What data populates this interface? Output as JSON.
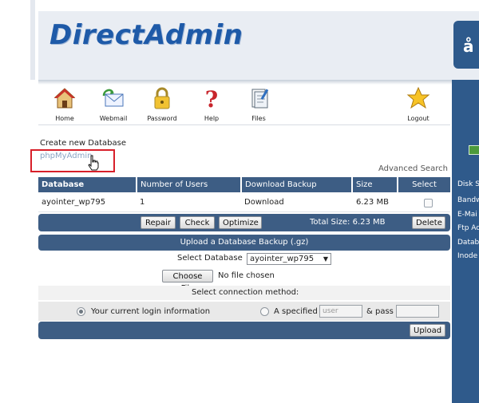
{
  "header": {
    "logo_text": "DirectAdmin",
    "side_tab_glyph": "å"
  },
  "toolbar": [
    {
      "label": "Home",
      "icon": "home-icon"
    },
    {
      "label": "Webmail",
      "icon": "webmail-icon"
    },
    {
      "label": "Password",
      "icon": "password-lock-icon"
    },
    {
      "label": "Help",
      "icon": "help-question-icon"
    },
    {
      "label": "Files",
      "icon": "files-icon"
    },
    {
      "label": "Logout",
      "icon": "logout-star-icon"
    }
  ],
  "links": {
    "create_db": "Create new Database",
    "phpmyadmin": "phpMyAdmin",
    "advanced_search": "Advanced Search"
  },
  "table": {
    "headers": [
      "Database",
      "Number of Users",
      "Download Backup",
      "Size",
      "Select"
    ],
    "rows": [
      {
        "database": "ayointer_wp795",
        "users": "1",
        "download": "Download",
        "size": "6.23 MB",
        "selected": false
      }
    ]
  },
  "actions": {
    "repair": "Repair",
    "check": "Check",
    "optimize": "Optimize",
    "total_size": "Total Size: 6.23 MB",
    "delete": "Delete"
  },
  "upload": {
    "title": "Upload a Database Backup (.gz)",
    "select_db_label": "Select Database",
    "select_db_value": "ayointer_wp795",
    "choose_file": "Choose File",
    "no_file": "No file chosen",
    "connection_label": "Select connection method:",
    "opt_current": "Your current login information",
    "opt_specified": "A specified",
    "user_placeholder": "user",
    "pass_label": "& pass",
    "upload_button": "Upload"
  },
  "side_panel": {
    "labels": [
      "Disk S",
      "Bandw",
      "E-Mai",
      "Ftp Ac",
      "Datab",
      "Inode"
    ]
  },
  "colors": {
    "brand_blue": "#1e5aa8",
    "bar_blue": "#3d5d84",
    "panel_blue": "#2f5a8b",
    "highlight_red": "#d8202a"
  }
}
